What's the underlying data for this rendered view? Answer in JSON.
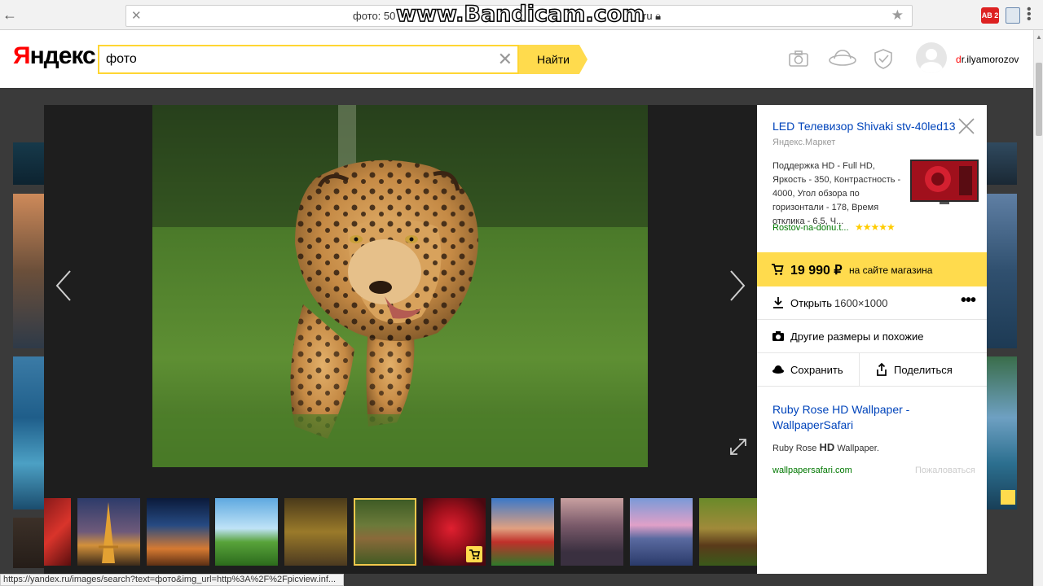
{
  "browser": {
    "url_text": "фото: 50",
    "url_tail": "ru",
    "watermark": "www.Bandicam.com",
    "ext_label": "AB 2"
  },
  "header": {
    "logo": "Яндекс",
    "logo_first": "Я",
    "logo_rest": "ндекс",
    "search_value": "фото",
    "search_button": "Найти",
    "username_first": "d",
    "username_rest": "r.ilyamorozov"
  },
  "panel": {
    "title": "LED Телевизор Shivaki stv-40led13",
    "source": "Яндекс.Маркет",
    "description": "Поддержка HD - Full HD, Яркость - 350, Контрастность - 4000, Угол обзора по горизонтали - 178, Время отклика - 6.5, Ч...",
    "store": "Rostov-na-donu.t...",
    "rating": 5,
    "price": "19 990 ₽",
    "price_where": "на сайте магазина",
    "open_label": "Открыть",
    "open_dims": "1600×1000",
    "similar_label": "Другие размеры и похожие",
    "save_label": "Сохранить",
    "share_label": "Поделиться",
    "related_title": "Ruby Rose HD Wallpaper - WallpaperSafari",
    "related_desc_pre": "Ruby Rose ",
    "related_desc_bold": "HD",
    "related_desc_post": " Wallpaper.",
    "related_site": "wallpapersafari.com",
    "complain": "Пожаловаться"
  },
  "thumbnails": [
    {
      "name": "red-car"
    },
    {
      "name": "eiffel-tower"
    },
    {
      "name": "city-night"
    },
    {
      "name": "green-field"
    },
    {
      "name": "atv"
    },
    {
      "name": "jaguar",
      "active": true
    },
    {
      "name": "red-rose",
      "cart": true
    },
    {
      "name": "tulip-field"
    },
    {
      "name": "city-aerial"
    },
    {
      "name": "mountain-lake"
    },
    {
      "name": "forest-cabin"
    }
  ],
  "status_bar": "https://yandex.ru/images/search?text=фото&img_url=http%3A%2F%2Fpicview.inf..."
}
